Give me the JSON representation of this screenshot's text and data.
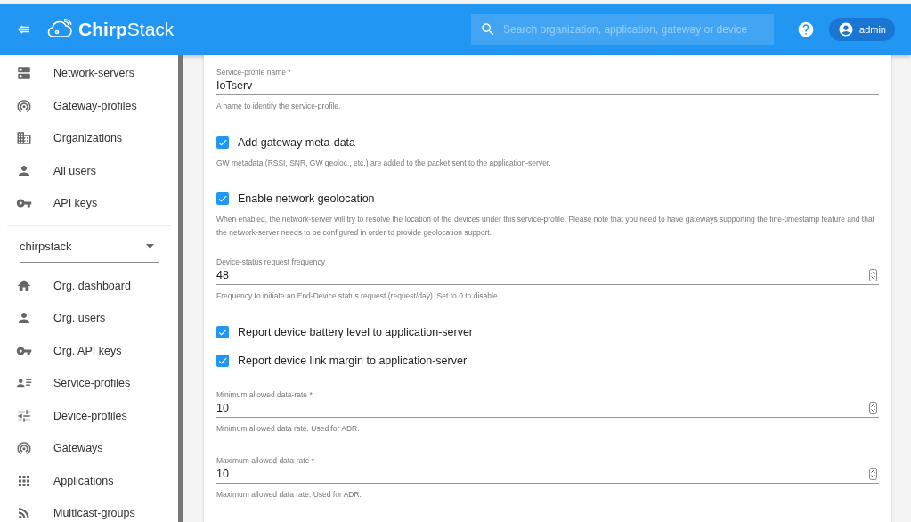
{
  "header": {
    "logo": "**Chirp**Stack",
    "search": {
      "placeholder": "Search organization, application, gateway or device"
    },
    "user": "admin"
  },
  "sidebar": {
    "items": [
      {
        "label": "Network-servers"
      },
      {
        "label": "Gateway-profiles"
      },
      {
        "label": "Organizations"
      },
      {
        "label": "All users"
      },
      {
        "label": "API keys"
      }
    ],
    "organization_select": "chirpstack",
    "org_items": [
      {
        "label": "Org. dashboard"
      },
      {
        "label": "Org. users"
      },
      {
        "label": "Org. API keys"
      },
      {
        "label": "Service-profiles"
      },
      {
        "label": "Device-profiles"
      },
      {
        "label": "Gateways"
      },
      {
        "label": "Applications"
      },
      {
        "label": "Multicast-groups"
      }
    ]
  },
  "form": {
    "fields": [
      {
        "kind": "text",
        "label": "Service-profile name *",
        "value": "IoTserv",
        "helper": "A name to identify the service-profile."
      },
      {
        "kind": "checkbox",
        "label": "Add gateway meta-data",
        "checked": true,
        "helper": "GW metadata (RSSI, SNR, GW geoloc., etc.) are added to the packet sent to the application-server."
      },
      {
        "kind": "checkbox",
        "label": "Enable network geolocation",
        "checked": true,
        "helper": "When enabled, the network-server will try to resolve the location of the devices under this service-profile. Please note that you need to have gateways supporting the fine-timestamp feature and that the network-server needs to be configured in order to provide geolocation support."
      },
      {
        "kind": "number",
        "label": "Device-status request frequency",
        "value": "48",
        "helper": "Frequency to initiate an End-Device status request (request/day). Set to 0 to disable."
      },
      {
        "kind": "checkbox",
        "label": "Report device battery level to application-server",
        "checked": true
      },
      {
        "kind": "checkbox",
        "label": "Report device link margin to application-server",
        "checked": true
      },
      {
        "kind": "number",
        "label": "Minimum allowed data-rate *",
        "value": "10",
        "helper": "Minimum allowed data rate. Used for ADR."
      },
      {
        "kind": "number",
        "label": "Maximum allowed data-rate *",
        "value": "10",
        "helper": "Maximum allowed data rate. Used for ADR."
      }
    ]
  }
}
